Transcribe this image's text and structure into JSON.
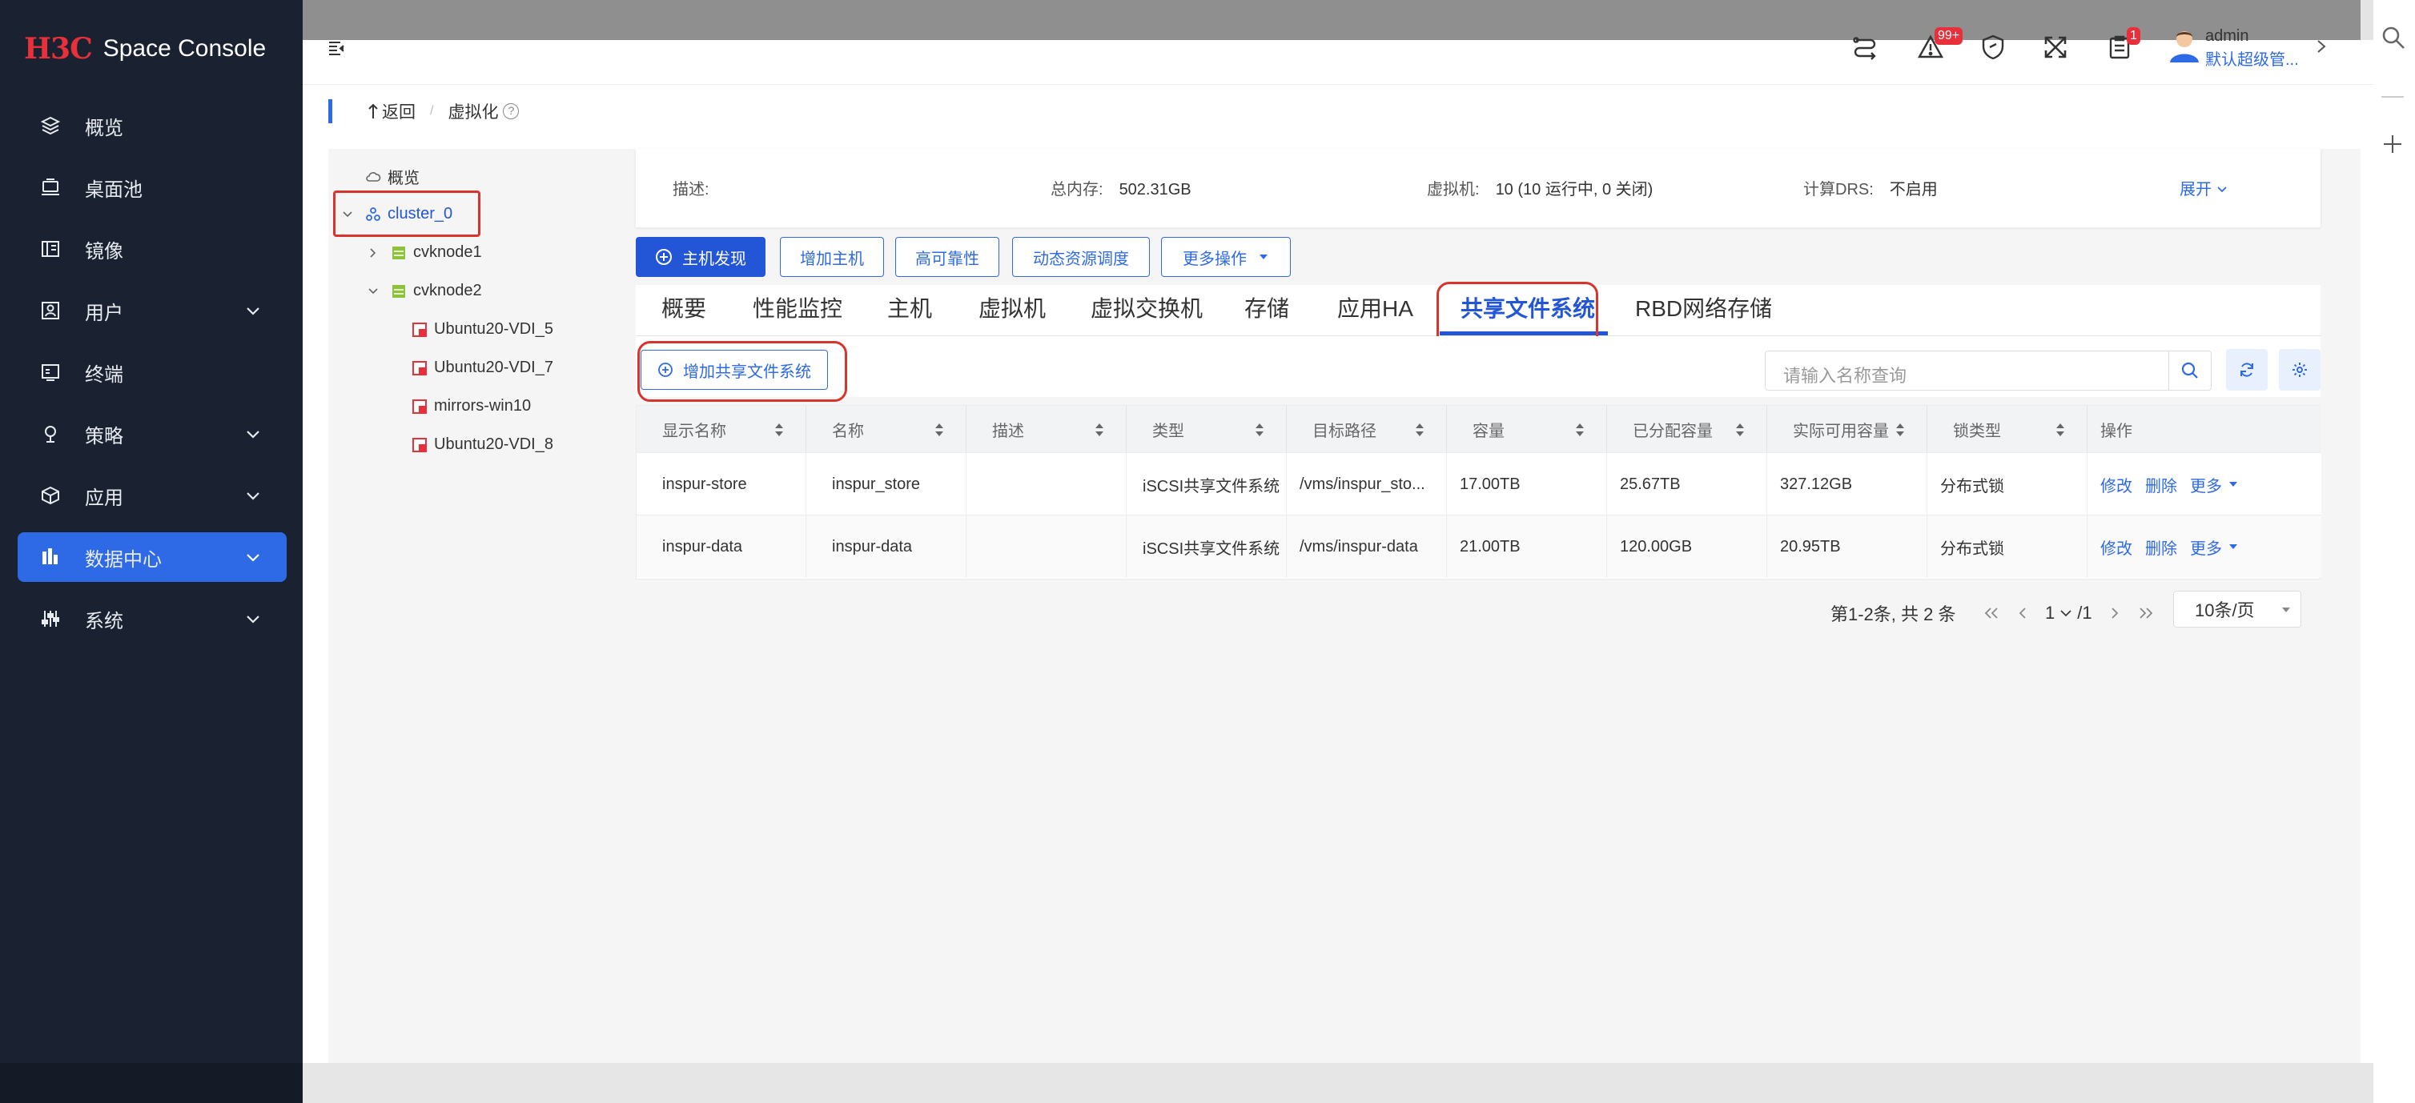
{
  "brand": {
    "logo": "H3C",
    "name": "Space Console"
  },
  "sidebar": {
    "items": [
      {
        "label": "概览",
        "icon": "layers-icon"
      },
      {
        "label": "桌面池",
        "icon": "desktop-pool-icon"
      },
      {
        "label": "镜像",
        "icon": "image-icon"
      },
      {
        "label": "用户",
        "icon": "user-icon"
      },
      {
        "label": "终端",
        "icon": "terminal-icon"
      },
      {
        "label": "策略",
        "icon": "policy-icon"
      },
      {
        "label": "应用",
        "icon": "app-icon"
      },
      {
        "label": "数据中心",
        "icon": "datacenter-icon"
      },
      {
        "label": "系统",
        "icon": "system-icon"
      }
    ]
  },
  "header": {
    "alert_badge": "99+",
    "task_badge": "1",
    "user_name": "admin",
    "user_role": "默认超级管..."
  },
  "breadcrumb": {
    "back": "返回",
    "current": "虚拟化"
  },
  "tree": {
    "overview": "概览",
    "cluster": "cluster_0",
    "nodes": [
      "cvknode1",
      "cvknode2"
    ],
    "vms": [
      "Ubuntu20-VDI_5",
      "Ubuntu20-VDI_7",
      "mirrors-win10",
      "Ubuntu20-VDI_8"
    ]
  },
  "info": {
    "desc_label": "描述:",
    "mem_label": "总内存:",
    "mem_value": "502.31GB",
    "vm_label": "虚拟机:",
    "vm_value": "10 (10 运行中, 0 关闭)",
    "drs_label": "计算DRS:",
    "drs_value": "不启用",
    "expand": "展开"
  },
  "actions": {
    "discover": "主机发现",
    "add_host": "增加主机",
    "ha": "高可靠性",
    "drs": "动态资源调度",
    "more": "更多操作"
  },
  "tabs": [
    "概要",
    "性能监控",
    "主机",
    "虚拟机",
    "虚拟交换机",
    "存储",
    "应用HA",
    "共享文件系统",
    "RBD网络存储"
  ],
  "toolbar": {
    "add_label": "增加共享文件系统",
    "search_placeholder": "请输入名称查询"
  },
  "table": {
    "headers": [
      "显示名称",
      "名称",
      "描述",
      "类型",
      "目标路径",
      "容量",
      "已分配容量",
      "实际可用容量",
      "锁类型",
      "操作"
    ],
    "rows": [
      {
        "display": "inspur-store",
        "name": "inspur_store",
        "desc": "",
        "type": "iSCSI共享文件系统",
        "path": "/vms/inspur_sto...",
        "capacity": "17.00TB",
        "allocated": "25.67TB",
        "available": "327.12GB",
        "lock": "分布式锁"
      },
      {
        "display": "inspur-data",
        "name": "inspur-data",
        "desc": "",
        "type": "iSCSI共享文件系统",
        "path": "/vms/inspur-data",
        "capacity": "21.00TB",
        "allocated": "120.00GB",
        "available": "20.95TB",
        "lock": "分布式锁"
      }
    ],
    "ops": {
      "edit": "修改",
      "delete": "删除",
      "more": "更多"
    }
  },
  "pager": {
    "summary": "第1-2条, 共 2 条",
    "page": "1",
    "total": "/1",
    "size": "10条/页"
  },
  "colors": {
    "accent": "#2356d6",
    "sidebar_bg": "#1a2232",
    "highlight": "#d8332c",
    "vm_icon": "#e8303a",
    "node_icon": "#8fc23c"
  }
}
